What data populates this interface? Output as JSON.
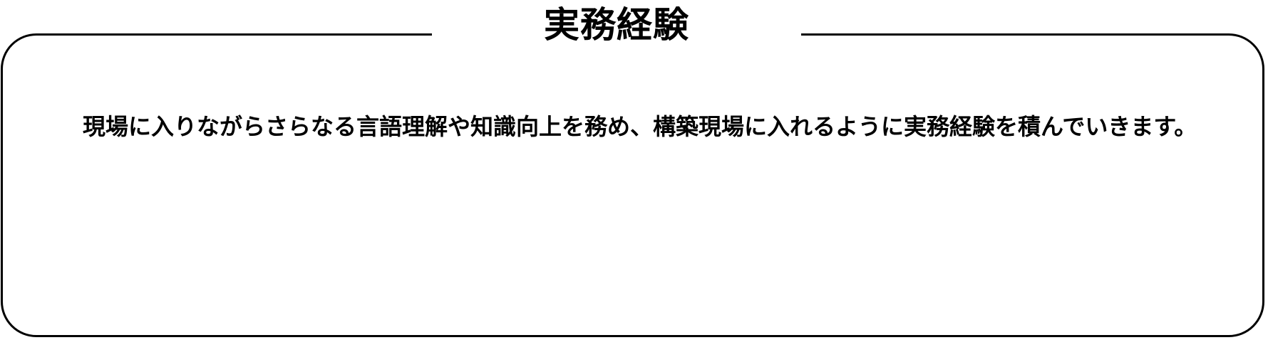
{
  "panel": {
    "title": "実務経験",
    "body": "現場に入りながらさらなる言語理解や知識向上を務め、構築現場に入れるように実務経験を積んでいきます。"
  },
  "colors": {
    "border": "#000000",
    "text": "#000000",
    "background": "#ffffff"
  }
}
